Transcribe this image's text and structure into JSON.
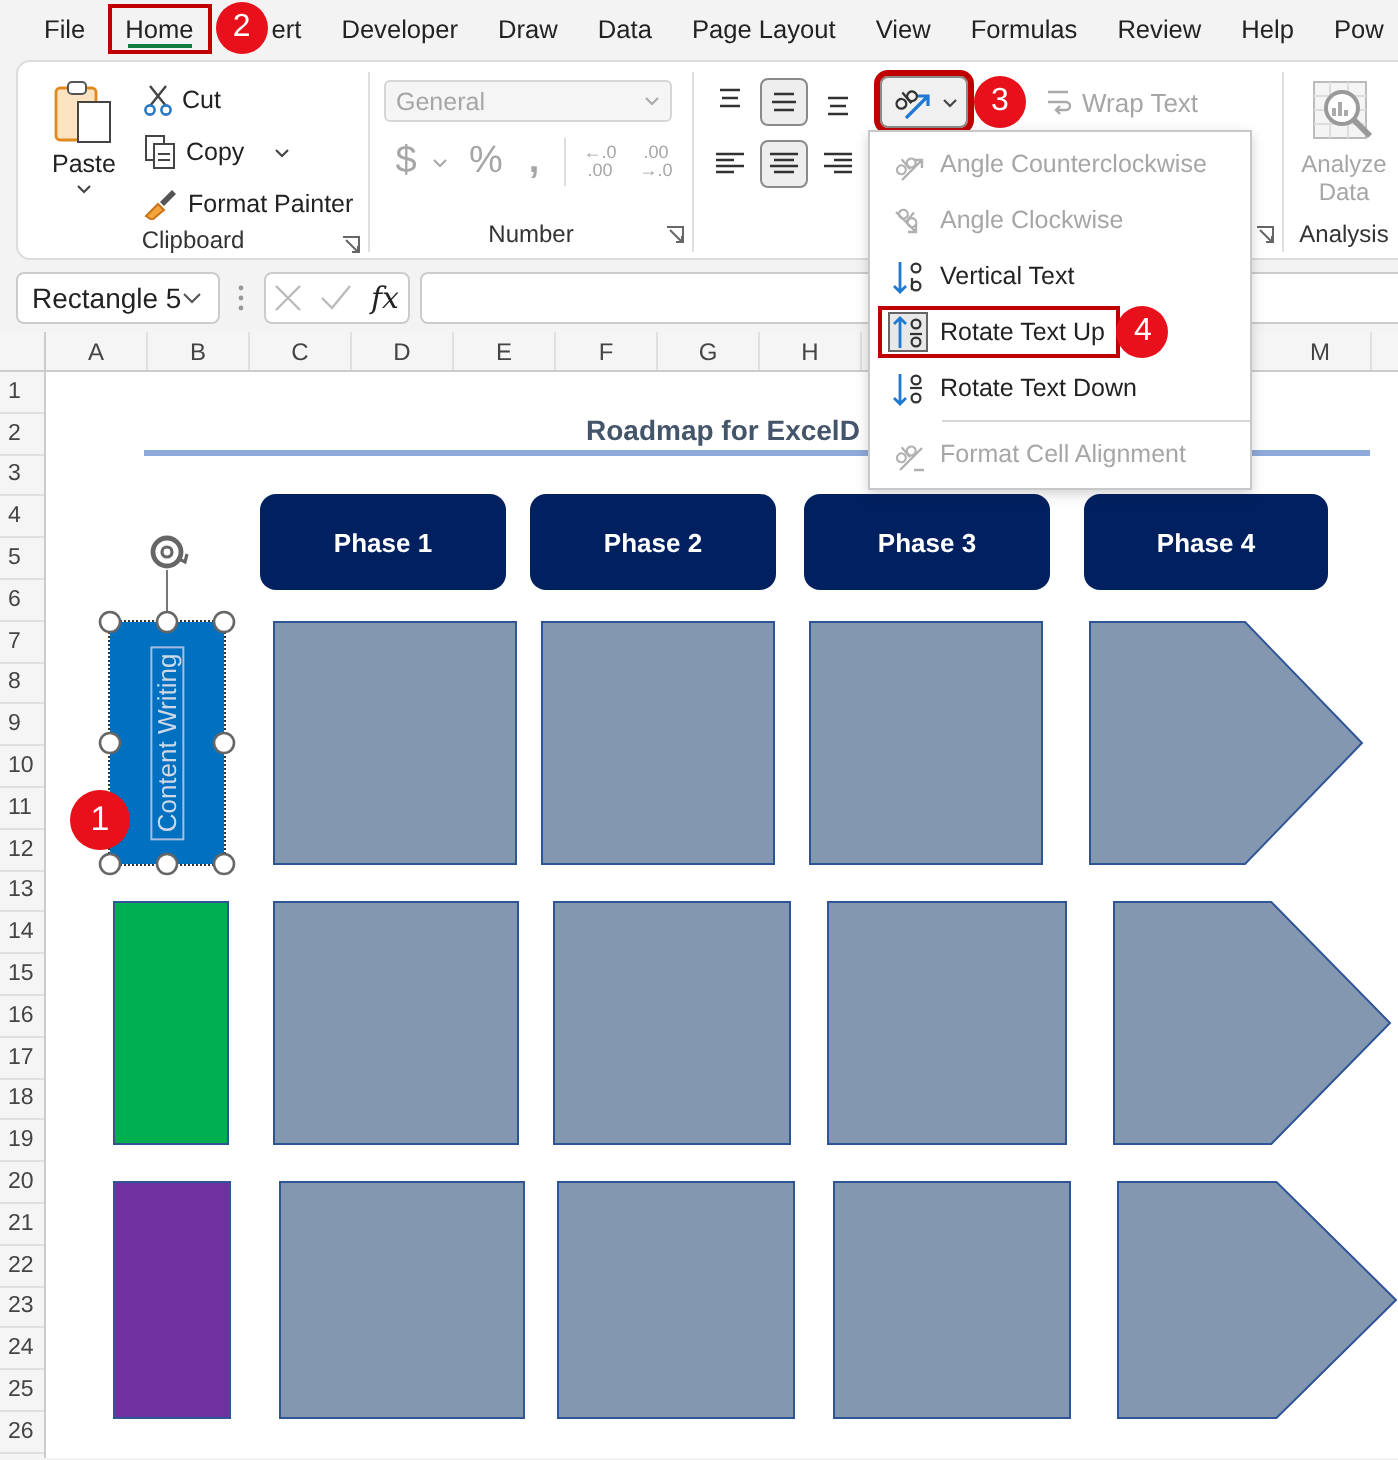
{
  "menu_tabs": [
    {
      "label": "File",
      "selected": false,
      "annotated": false
    },
    {
      "label": "Home",
      "selected": true,
      "annotated": true
    },
    {
      "label": "ert",
      "selected": false,
      "annotated": false
    },
    {
      "label": "Developer",
      "selected": false,
      "annotated": false
    },
    {
      "label": "Draw",
      "selected": false,
      "annotated": false
    },
    {
      "label": "Data",
      "selected": false,
      "annotated": false
    },
    {
      "label": "Page Layout",
      "selected": false,
      "annotated": false
    },
    {
      "label": "View",
      "selected": false,
      "annotated": false
    },
    {
      "label": "Formulas",
      "selected": false,
      "annotated": false
    },
    {
      "label": "Review",
      "selected": false,
      "annotated": false
    },
    {
      "label": "Help",
      "selected": false,
      "annotated": false
    },
    {
      "label": "Pow",
      "selected": false,
      "annotated": false
    }
  ],
  "callouts": [
    {
      "number": "1"
    },
    {
      "number": "2"
    },
    {
      "number": "3"
    },
    {
      "number": "4"
    }
  ],
  "ribbon": {
    "clipboard": {
      "paste": "Paste",
      "cut": "Cut",
      "copy": "Copy",
      "format_painter": "Format Painter",
      "label": "Clipboard"
    },
    "number": {
      "disabled": true,
      "format": "General",
      "currency": "$",
      "percent": "%",
      "comma": ",",
      "increase_decimal": [
        "←.0",
        ".00"
      ],
      "decrease_decimal": [
        ".00",
        "→.0"
      ],
      "label": "Number"
    },
    "alignment": {
      "vertical_align": [
        {
          "selected": false
        },
        {
          "selected": true
        },
        {
          "selected": false
        }
      ],
      "horizontal_align": [
        {
          "selected": false
        },
        {
          "selected": true
        },
        {
          "selected": false
        }
      ],
      "orientation": {
        "pressed": true,
        "annotated": true
      },
      "wrap_text": {
        "label": "Wrap Text",
        "disabled": true
      }
    },
    "analysis": {
      "analyze_data": "Analyze Data",
      "disabled": true,
      "label": "Analysis"
    }
  },
  "orientation_menu": {
    "items": [
      {
        "label": "Angle Counterclockwise",
        "disabled": true,
        "checked": false,
        "annotated": false,
        "separator_before": false
      },
      {
        "label": "Angle Clockwise",
        "disabled": true,
        "checked": false,
        "annotated": false,
        "separator_before": false
      },
      {
        "label": "Vertical Text",
        "disabled": false,
        "checked": false,
        "annotated": false,
        "separator_before": false
      },
      {
        "label": "Rotate Text Up",
        "disabled": false,
        "checked": true,
        "annotated": true,
        "separator_before": false
      },
      {
        "label": "Rotate Text Down",
        "disabled": false,
        "checked": false,
        "annotated": false,
        "separator_before": false
      },
      {
        "label": "Format Cell Alignment",
        "disabled": true,
        "checked": false,
        "annotated": false,
        "separator_before": true
      }
    ]
  },
  "formula_bar": {
    "name_box": "Rectangle 5",
    "function_label": "fx"
  },
  "sheet": {
    "columns": [
      "A",
      "B",
      "C",
      "D",
      "E",
      "F",
      "G",
      "H",
      "M"
    ],
    "rows": [
      "1",
      "2",
      "3",
      "4",
      "5",
      "6",
      "7",
      "8",
      "9",
      "10",
      "11",
      "12",
      "13",
      "14",
      "15",
      "16",
      "17",
      "18",
      "19",
      "20",
      "21",
      "22",
      "23",
      "24",
      "25",
      "26"
    ],
    "title": "Roadmap for ExcelD",
    "phases": [
      "Phase 1",
      "Phase 2",
      "Phase 3",
      "Phase 4"
    ],
    "shape_rows": [
      {
        "color": "#0070c0",
        "selected": true,
        "text": "Content Writing"
      },
      {
        "color": "#00b050",
        "selected": false
      },
      {
        "color": "#7030a0",
        "selected": false
      }
    ]
  }
}
